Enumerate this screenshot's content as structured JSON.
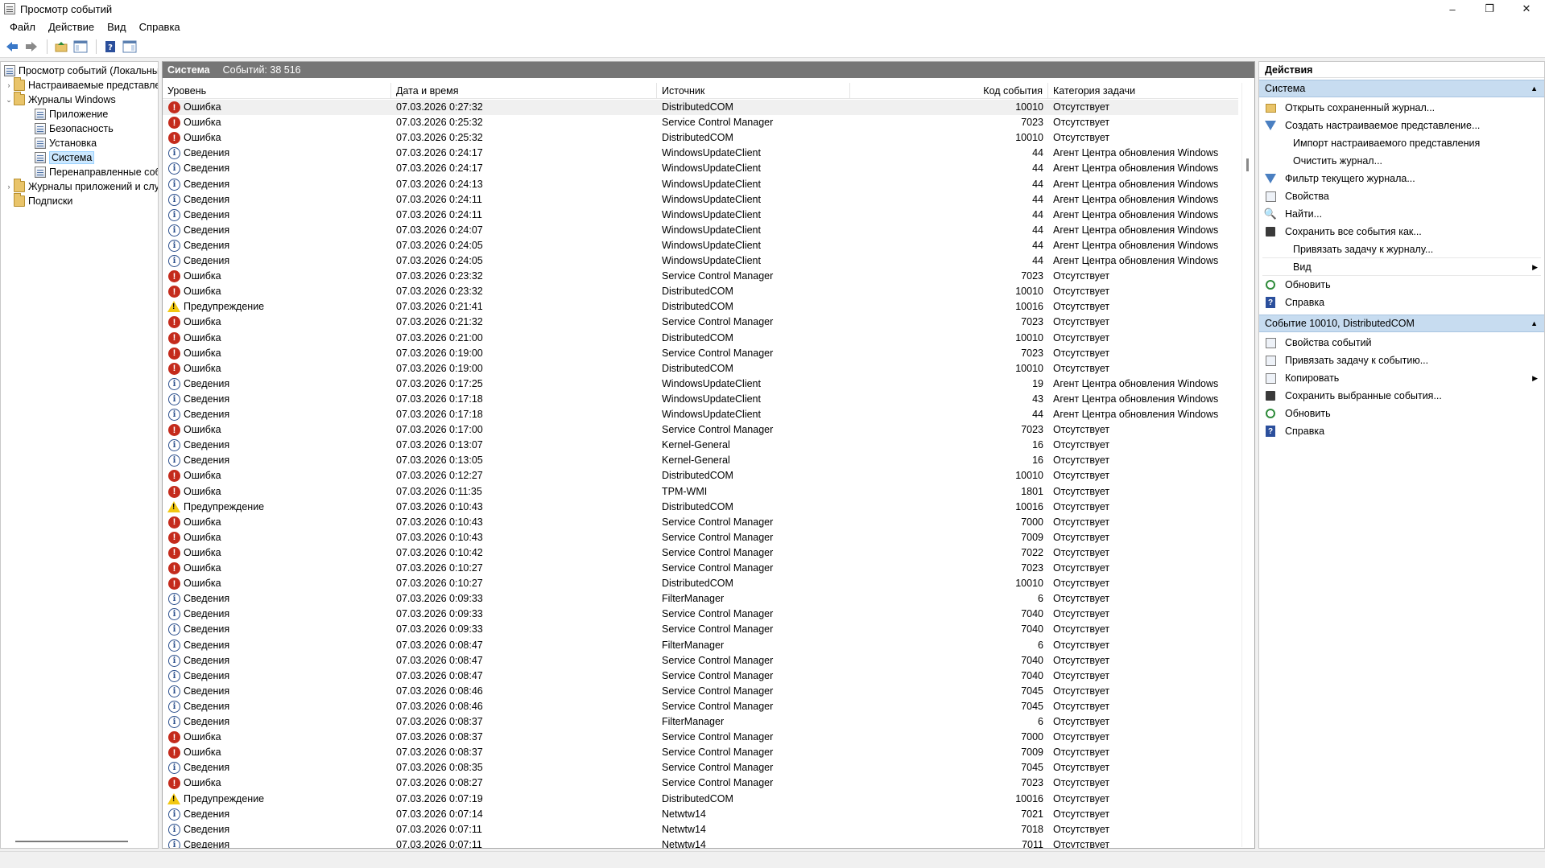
{
  "window": {
    "title": "Просмотр событий",
    "minimize": "–",
    "maximize": "❐",
    "close": "✕"
  },
  "menu": [
    "Файл",
    "Действие",
    "Вид",
    "Справка"
  ],
  "toolbar": {
    "icons": [
      "back-arrow-icon",
      "forward-arrow-icon",
      "up-folder-icon",
      "show-hide-tree-icon",
      "help-icon",
      "show-hide-actions-icon"
    ]
  },
  "tree": {
    "items": [
      {
        "label": "Просмотр событий (Локальный)",
        "expander": "",
        "icon": "event-viewer-icon"
      },
      {
        "label": "Настраиваемые представления",
        "expander": "›",
        "icon": "folder-icon"
      },
      {
        "label": "Журналы Windows",
        "expander": "⌄",
        "icon": "folder-icon"
      },
      {
        "label": "Приложение",
        "expander": "",
        "icon": "log-icon"
      },
      {
        "label": "Безопасность",
        "expander": "",
        "icon": "log-icon"
      },
      {
        "label": "Установка",
        "expander": "",
        "icon": "log-icon"
      },
      {
        "label": "Система",
        "expander": "",
        "icon": "log-icon"
      },
      {
        "label": "Перенаправленные события",
        "expander": "",
        "icon": "log-icon"
      },
      {
        "label": "Журналы приложений и служб",
        "expander": "›",
        "icon": "folder-icon"
      },
      {
        "label": "Подписки",
        "expander": "",
        "icon": "folder-icon"
      }
    ]
  },
  "center": {
    "title": "Система",
    "count_label": "Событий: 38 516",
    "columns": [
      "Уровень",
      "Дата и время",
      "Источник",
      "Код события",
      "Категория задачи"
    ],
    "rows": [
      {
        "level": "Ошибка",
        "type": "error",
        "date": "07.03.2026 0:27:32",
        "source": "DistributedCOM",
        "code": "10010",
        "category": "Отсутствует"
      },
      {
        "level": "Ошибка",
        "type": "error",
        "date": "07.03.2026 0:25:32",
        "source": "Service Control Manager",
        "code": "7023",
        "category": "Отсутствует"
      },
      {
        "level": "Ошибка",
        "type": "error",
        "date": "07.03.2026 0:25:32",
        "source": "DistributedCOM",
        "code": "10010",
        "category": "Отсутствует"
      },
      {
        "level": "Сведения",
        "type": "info",
        "date": "07.03.2026 0:24:17",
        "source": "WindowsUpdateClient",
        "code": "44",
        "category": "Агент Центра обновления Windows"
      },
      {
        "level": "Сведения",
        "type": "info",
        "date": "07.03.2026 0:24:17",
        "source": "WindowsUpdateClient",
        "code": "44",
        "category": "Агент Центра обновления Windows"
      },
      {
        "level": "Сведения",
        "type": "info",
        "date": "07.03.2026 0:24:13",
        "source": "WindowsUpdateClient",
        "code": "44",
        "category": "Агент Центра обновления Windows"
      },
      {
        "level": "Сведения",
        "type": "info",
        "date": "07.03.2026 0:24:11",
        "source": "WindowsUpdateClient",
        "code": "44",
        "category": "Агент Центра обновления Windows"
      },
      {
        "level": "Сведения",
        "type": "info",
        "date": "07.03.2026 0:24:11",
        "source": "WindowsUpdateClient",
        "code": "44",
        "category": "Агент Центра обновления Windows"
      },
      {
        "level": "Сведения",
        "type": "info",
        "date": "07.03.2026 0:24:07",
        "source": "WindowsUpdateClient",
        "code": "44",
        "category": "Агент Центра обновления Windows"
      },
      {
        "level": "Сведения",
        "type": "info",
        "date": "07.03.2026 0:24:05",
        "source": "WindowsUpdateClient",
        "code": "44",
        "category": "Агент Центра обновления Windows"
      },
      {
        "level": "Сведения",
        "type": "info",
        "date": "07.03.2026 0:24:05",
        "source": "WindowsUpdateClient",
        "code": "44",
        "category": "Агент Центра обновления Windows"
      },
      {
        "level": "Ошибка",
        "type": "error",
        "date": "07.03.2026 0:23:32",
        "source": "Service Control Manager",
        "code": "7023",
        "category": "Отсутствует"
      },
      {
        "level": "Ошибка",
        "type": "error",
        "date": "07.03.2026 0:23:32",
        "source": "DistributedCOM",
        "code": "10010",
        "category": "Отсутствует"
      },
      {
        "level": "Предупреждение",
        "type": "warn",
        "date": "07.03.2026 0:21:41",
        "source": "DistributedCOM",
        "code": "10016",
        "category": "Отсутствует"
      },
      {
        "level": "Ошибка",
        "type": "error",
        "date": "07.03.2026 0:21:32",
        "source": "Service Control Manager",
        "code": "7023",
        "category": "Отсутствует"
      },
      {
        "level": "Ошибка",
        "type": "error",
        "date": "07.03.2026 0:21:00",
        "source": "DistributedCOM",
        "code": "10010",
        "category": "Отсутствует"
      },
      {
        "level": "Ошибка",
        "type": "error",
        "date": "07.03.2026 0:19:00",
        "source": "Service Control Manager",
        "code": "7023",
        "category": "Отсутствует"
      },
      {
        "level": "Ошибка",
        "type": "error",
        "date": "07.03.2026 0:19:00",
        "source": "DistributedCOM",
        "code": "10010",
        "category": "Отсутствует"
      },
      {
        "level": "Сведения",
        "type": "info",
        "date": "07.03.2026 0:17:25",
        "source": "WindowsUpdateClient",
        "code": "19",
        "category": "Агент Центра обновления Windows"
      },
      {
        "level": "Сведения",
        "type": "info",
        "date": "07.03.2026 0:17:18",
        "source": "WindowsUpdateClient",
        "code": "43",
        "category": "Агент Центра обновления Windows"
      },
      {
        "level": "Сведения",
        "type": "info",
        "date": "07.03.2026 0:17:18",
        "source": "WindowsUpdateClient",
        "code": "44",
        "category": "Агент Центра обновления Windows"
      },
      {
        "level": "Ошибка",
        "type": "error",
        "date": "07.03.2026 0:17:00",
        "source": "Service Control Manager",
        "code": "7023",
        "category": "Отсутствует"
      },
      {
        "level": "Сведения",
        "type": "info",
        "date": "07.03.2026 0:13:07",
        "source": "Kernel-General",
        "code": "16",
        "category": "Отсутствует"
      },
      {
        "level": "Сведения",
        "type": "info",
        "date": "07.03.2026 0:13:05",
        "source": "Kernel-General",
        "code": "16",
        "category": "Отсутствует"
      },
      {
        "level": "Ошибка",
        "type": "error",
        "date": "07.03.2026 0:12:27",
        "source": "DistributedCOM",
        "code": "10010",
        "category": "Отсутствует"
      },
      {
        "level": "Ошибка",
        "type": "error",
        "date": "07.03.2026 0:11:35",
        "source": "TPM-WMI",
        "code": "1801",
        "category": "Отсутствует"
      },
      {
        "level": "Предупреждение",
        "type": "warn",
        "date": "07.03.2026 0:10:43",
        "source": "DistributedCOM",
        "code": "10016",
        "category": "Отсутствует"
      },
      {
        "level": "Ошибка",
        "type": "error",
        "date": "07.03.2026 0:10:43",
        "source": "Service Control Manager",
        "code": "7000",
        "category": "Отсутствует"
      },
      {
        "level": "Ошибка",
        "type": "error",
        "date": "07.03.2026 0:10:43",
        "source": "Service Control Manager",
        "code": "7009",
        "category": "Отсутствует"
      },
      {
        "level": "Ошибка",
        "type": "error",
        "date": "07.03.2026 0:10:42",
        "source": "Service Control Manager",
        "code": "7022",
        "category": "Отсутствует"
      },
      {
        "level": "Ошибка",
        "type": "error",
        "date": "07.03.2026 0:10:27",
        "source": "Service Control Manager",
        "code": "7023",
        "category": "Отсутствует"
      },
      {
        "level": "Ошибка",
        "type": "error",
        "date": "07.03.2026 0:10:27",
        "source": "DistributedCOM",
        "code": "10010",
        "category": "Отсутствует"
      },
      {
        "level": "Сведения",
        "type": "info",
        "date": "07.03.2026 0:09:33",
        "source": "FilterManager",
        "code": "6",
        "category": "Отсутствует"
      },
      {
        "level": "Сведения",
        "type": "info",
        "date": "07.03.2026 0:09:33",
        "source": "Service Control Manager",
        "code": "7040",
        "category": "Отсутствует"
      },
      {
        "level": "Сведения",
        "type": "info",
        "date": "07.03.2026 0:09:33",
        "source": "Service Control Manager",
        "code": "7040",
        "category": "Отсутствует"
      },
      {
        "level": "Сведения",
        "type": "info",
        "date": "07.03.2026 0:08:47",
        "source": "FilterManager",
        "code": "6",
        "category": "Отсутствует"
      },
      {
        "level": "Сведения",
        "type": "info",
        "date": "07.03.2026 0:08:47",
        "source": "Service Control Manager",
        "code": "7040",
        "category": "Отсутствует"
      },
      {
        "level": "Сведения",
        "type": "info",
        "date": "07.03.2026 0:08:47",
        "source": "Service Control Manager",
        "code": "7040",
        "category": "Отсутствует"
      },
      {
        "level": "Сведения",
        "type": "info",
        "date": "07.03.2026 0:08:46",
        "source": "Service Control Manager",
        "code": "7045",
        "category": "Отсутствует"
      },
      {
        "level": "Сведения",
        "type": "info",
        "date": "07.03.2026 0:08:46",
        "source": "Service Control Manager",
        "code": "7045",
        "category": "Отсутствует"
      },
      {
        "level": "Сведения",
        "type": "info",
        "date": "07.03.2026 0:08:37",
        "source": "FilterManager",
        "code": "6",
        "category": "Отсутствует"
      },
      {
        "level": "Ошибка",
        "type": "error",
        "date": "07.03.2026 0:08:37",
        "source": "Service Control Manager",
        "code": "7000",
        "category": "Отсутствует"
      },
      {
        "level": "Ошибка",
        "type": "error",
        "date": "07.03.2026 0:08:37",
        "source": "Service Control Manager",
        "code": "7009",
        "category": "Отсутствует"
      },
      {
        "level": "Сведения",
        "type": "info",
        "date": "07.03.2026 0:08:35",
        "source": "Service Control Manager",
        "code": "7045",
        "category": "Отсутствует"
      },
      {
        "level": "Ошибка",
        "type": "error",
        "date": "07.03.2026 0:08:27",
        "source": "Service Control Manager",
        "code": "7023",
        "category": "Отсутствует"
      },
      {
        "level": "Предупреждение",
        "type": "warn",
        "date": "07.03.2026 0:07:19",
        "source": "DistributedCOM",
        "code": "10016",
        "category": "Отсутствует"
      },
      {
        "level": "Сведения",
        "type": "info",
        "date": "07.03.2026 0:07:14",
        "source": "Netwtw14",
        "code": "7021",
        "category": "Отсутствует"
      },
      {
        "level": "Сведения",
        "type": "info",
        "date": "07.03.2026 0:07:11",
        "source": "Netwtw14",
        "code": "7018",
        "category": "Отсутствует"
      },
      {
        "level": "Сведения",
        "type": "info",
        "date": "07.03.2026 0:07:11",
        "source": "Netwtw14",
        "code": "7011",
        "category": "Отсутствует"
      }
    ]
  },
  "actions": {
    "title": "Действия",
    "section1": {
      "title": "Система",
      "items": [
        {
          "label": "Открыть сохраненный журнал...",
          "icon": "open-log-icon"
        },
        {
          "label": "Создать настраиваемое представление...",
          "icon": "filter-create-icon"
        },
        {
          "label": "Импорт настраиваемого представления",
          "icon": ""
        },
        {
          "label": "Очистить журнал...",
          "icon": ""
        },
        {
          "label": "Фильтр текущего журнала...",
          "icon": "filter-icon"
        },
        {
          "label": "Свойства",
          "icon": "properties-icon"
        },
        {
          "label": "Найти...",
          "icon": "find-icon"
        },
        {
          "label": "Сохранить все события как...",
          "icon": "save-icon"
        },
        {
          "label": "Привязать задачу к журналу...",
          "icon": ""
        },
        {
          "label": "Вид",
          "icon": "",
          "submenu": "▶"
        },
        {
          "label": "Обновить",
          "icon": "refresh-icon"
        },
        {
          "label": "Справка",
          "icon": "help-icon"
        }
      ]
    },
    "section2": {
      "title": "Событие 10010, DistributedCOM",
      "items": [
        {
          "label": "Свойства событий",
          "icon": "properties-icon"
        },
        {
          "label": "Привязать задачу к событию...",
          "icon": "task-icon"
        },
        {
          "label": "Копировать",
          "icon": "copy-icon",
          "submenu": "▶"
        },
        {
          "label": "Сохранить выбранные события...",
          "icon": "save-icon"
        },
        {
          "label": "Обновить",
          "icon": "refresh-icon"
        },
        {
          "label": "Справка",
          "icon": "help-icon"
        }
      ]
    },
    "caret": "▲"
  },
  "colors": {
    "header_bg": "#767676",
    "section_bg": "#c7dcf0",
    "error": "#c42b1c",
    "info": "#2b4f8c",
    "warning": "#f2c811",
    "selection": "#cce8ff"
  }
}
